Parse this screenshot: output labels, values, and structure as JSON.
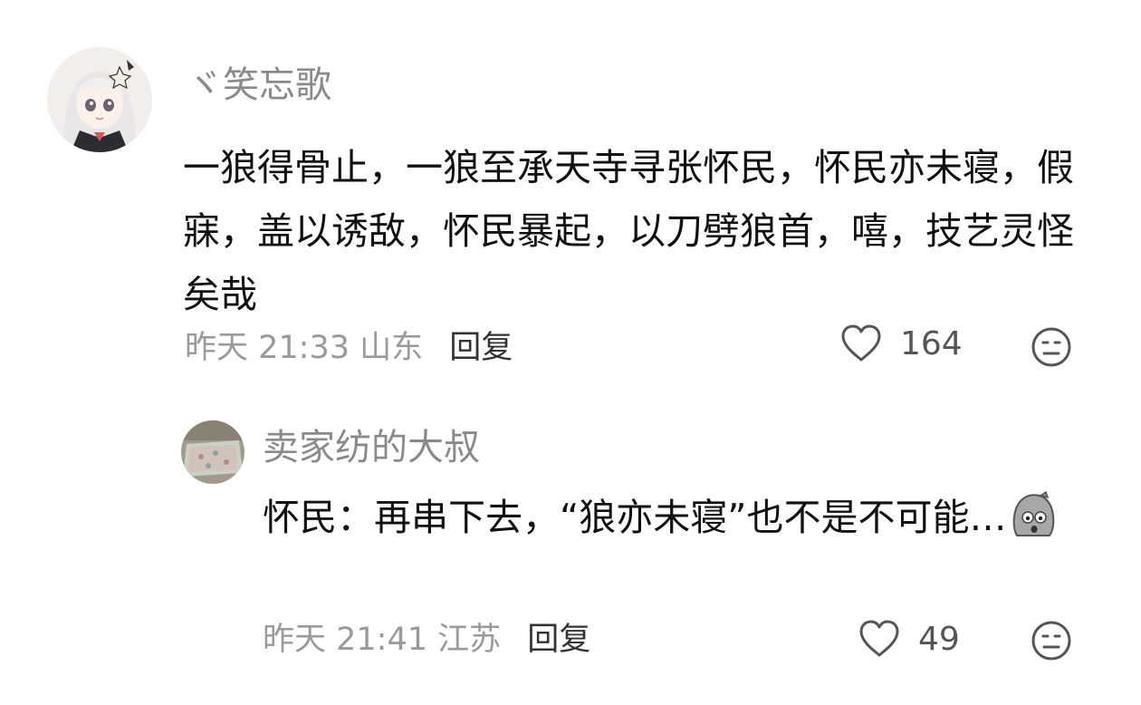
{
  "comments": [
    {
      "username": "ヾ笑忘歌",
      "content": "一狼得骨止，一狼至承天寺寻张怀民，怀民亦未寝，假寐，盖以诱敌，怀民暴起，以刀劈狼首，嘻，技艺灵怪矣哉",
      "time": "昨天 21:33",
      "location": "山东",
      "reply_label": "回复",
      "likes": "164",
      "avatar_icon": "anime-girl-avatar"
    },
    {
      "username": "卖家纺的大叔",
      "content": "怀民：再串下去，“狼亦未寝”也不是不可能…",
      "sticker_icon": "shocked-face-sticker",
      "time": "昨天 21:41",
      "location": "江苏",
      "reply_label": "回复",
      "likes": "49",
      "avatar_icon": "bed-product-avatar"
    }
  ],
  "colors": {
    "text": "#111111",
    "meta": "#9a9a9a",
    "username": "#8a8a8a"
  }
}
